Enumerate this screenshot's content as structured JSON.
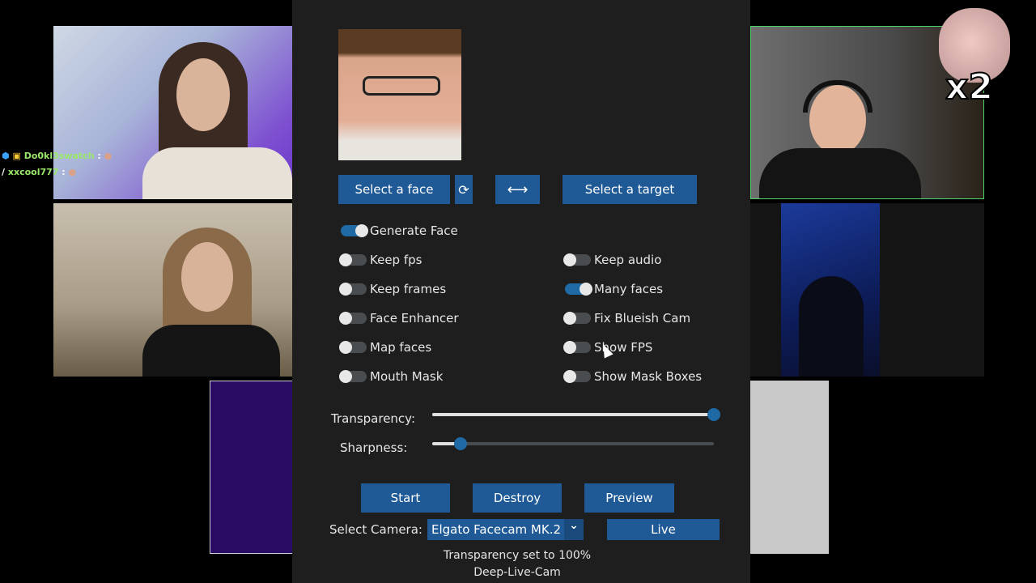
{
  "chat": [
    {
      "user": "Do0kl3swatch",
      "sep": ":"
    },
    {
      "user": "xxcool777",
      "sep": ":"
    }
  ],
  "overlay_text": "x2",
  "buttons": {
    "select_face": "Select a face",
    "refresh_icon": "⟳",
    "swap_icon": "⟷",
    "select_target": "Select a target",
    "start": "Start",
    "destroy": "Destroy",
    "preview": "Preview",
    "live": "Live"
  },
  "switches": {
    "generate_face": {
      "label": "Generate Face",
      "on": true
    },
    "keep_fps": {
      "label": "Keep fps",
      "on": false
    },
    "keep_frames": {
      "label": "Keep frames",
      "on": false
    },
    "face_enhancer": {
      "label": "Face Enhancer",
      "on": false
    },
    "map_faces": {
      "label": "Map faces",
      "on": false
    },
    "mouth_mask": {
      "label": "Mouth Mask",
      "on": false
    },
    "keep_audio": {
      "label": "Keep audio",
      "on": false
    },
    "many_faces": {
      "label": "Many faces",
      "on": true
    },
    "fix_blueish_cam": {
      "label": "Fix Blueish Cam",
      "on": false
    },
    "show_fps": {
      "label": "Show FPS",
      "on": false
    },
    "show_mask_boxes": {
      "label": "Show Mask Boxes",
      "on": false
    }
  },
  "sliders": {
    "transparency": {
      "label": "Transparency:",
      "value": 1.0
    },
    "sharpness": {
      "label": "Sharpness:",
      "value": 0.1
    }
  },
  "camera": {
    "label": "Select Camera:",
    "value": "Elgato Facecam MK.2",
    "chevron_icon": "⌄"
  },
  "status": {
    "message": "Transparency set to 100%",
    "app_name": "Deep-Live-Cam"
  },
  "colors": {
    "accent": "#1f6aa5",
    "button": "#1f5a96",
    "panel": "#1e1e1e"
  }
}
